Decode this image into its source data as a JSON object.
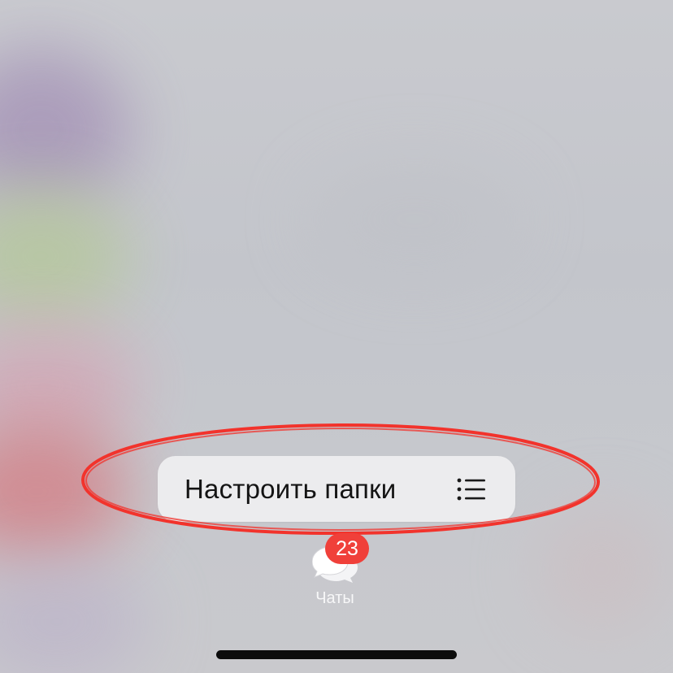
{
  "context_menu": {
    "item_label": "Настроить папки",
    "item_icon": "list-icon"
  },
  "tab_bar": {
    "chats": {
      "label": "Чаты",
      "icon": "chat-bubbles-icon",
      "badge_count": "23"
    }
  },
  "annotation": {
    "shape": "hand-drawn ellipse",
    "color": "#f2332c"
  },
  "colors": {
    "menu_background": "#ececee",
    "badge": "#f0403a",
    "tab_label": "#f7f7f8",
    "home_indicator": "#0c0c0c"
  }
}
